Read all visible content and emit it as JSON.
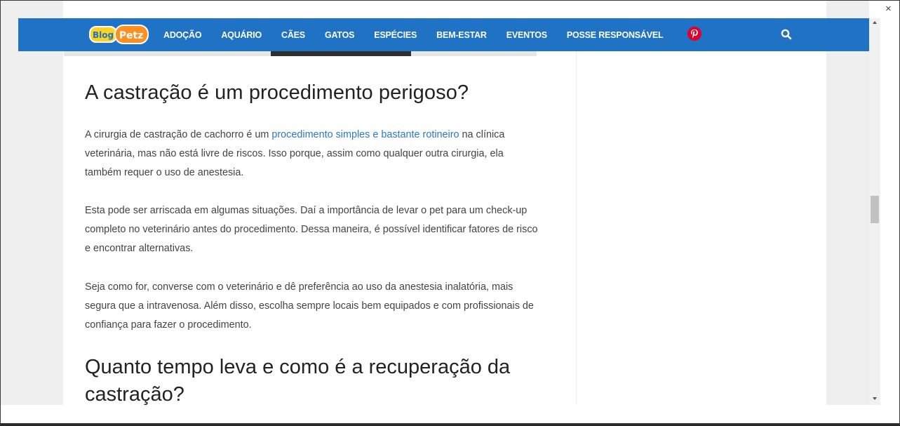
{
  "nav": {
    "items": [
      "ADOÇÃO",
      "AQUÁRIO",
      "CÃES",
      "GATOS",
      "ESPÉCIES",
      "BEM-ESTAR",
      "EVENTOS",
      "POSSE RESPONSÁVEL"
    ],
    "logo_text": "BlogPetz",
    "brand_color": "#1f72c4",
    "pinterest_color": "#e0002a"
  },
  "article": {
    "heading1": "A castração é um procedimento perigoso?",
    "p1_before": "A cirurgia de castração de cachorro é um ",
    "p1_link": "procedimento simples e bastante rotineiro",
    "p1_after": " na clínica veterinária, mas não está livre de riscos. Isso porque, assim como qualquer outra cirurgia, ela também requer o uso de anestesia.",
    "p2": "Esta pode ser arriscada em algumas situações. Daí a importância de levar o pet para um check-up completo no veterinário antes do procedimento. Dessa maneira, é possível identificar fatores de risco e encontrar alternativas.",
    "p3": "Seja como for, converse com o veterinário e dê preferência ao uso da anestesia inalatória, mais segura que a intravenosa. Além disso, escolha sempre locais bem equipados e com profissionais de confiança para fazer o procedimento.",
    "heading2": "Quanto tempo leva e como é a recuperação da castração?"
  },
  "window": {
    "close_glyph": "×"
  }
}
